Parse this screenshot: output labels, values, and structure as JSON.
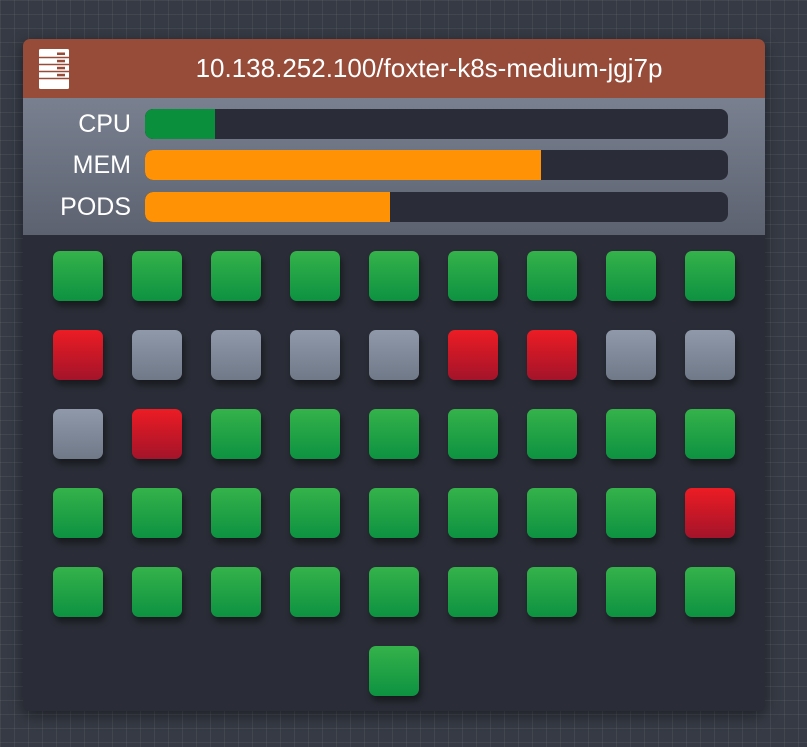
{
  "node": {
    "title": "10.138.252.100/foxter-k8s-medium-jgj7p",
    "icon": "server-icon",
    "header_color": "#974b39"
  },
  "metrics": [
    {
      "id": "cpu",
      "label": "CPU",
      "fraction": 0.12,
      "color": "#0a8f3c"
    },
    {
      "id": "mem",
      "label": "MEM",
      "fraction": 0.68,
      "color": "#ff9305"
    },
    {
      "id": "pods",
      "label": "PODS",
      "fraction": 0.42,
      "color": "#ff9305"
    }
  ],
  "pods": {
    "status_colors": {
      "ok": "#1fa347",
      "error": "#d01a27",
      "idle": "#818a9a"
    },
    "rows": [
      [
        "ok",
        "ok",
        "ok",
        "ok",
        "ok",
        "ok",
        "ok",
        "ok",
        "ok"
      ],
      [
        "error",
        "idle",
        "idle",
        "idle",
        "idle",
        "error",
        "error",
        "idle",
        "idle"
      ],
      [
        "idle",
        "error",
        "ok",
        "ok",
        "ok",
        "ok",
        "ok",
        "ok",
        "ok"
      ],
      [
        "ok",
        "ok",
        "ok",
        "ok",
        "ok",
        "ok",
        "ok",
        "ok",
        "error"
      ],
      [
        "ok",
        "ok",
        "ok",
        "ok",
        "ok",
        "ok",
        "ok",
        "ok",
        "ok"
      ],
      [
        "ok"
      ]
    ]
  }
}
